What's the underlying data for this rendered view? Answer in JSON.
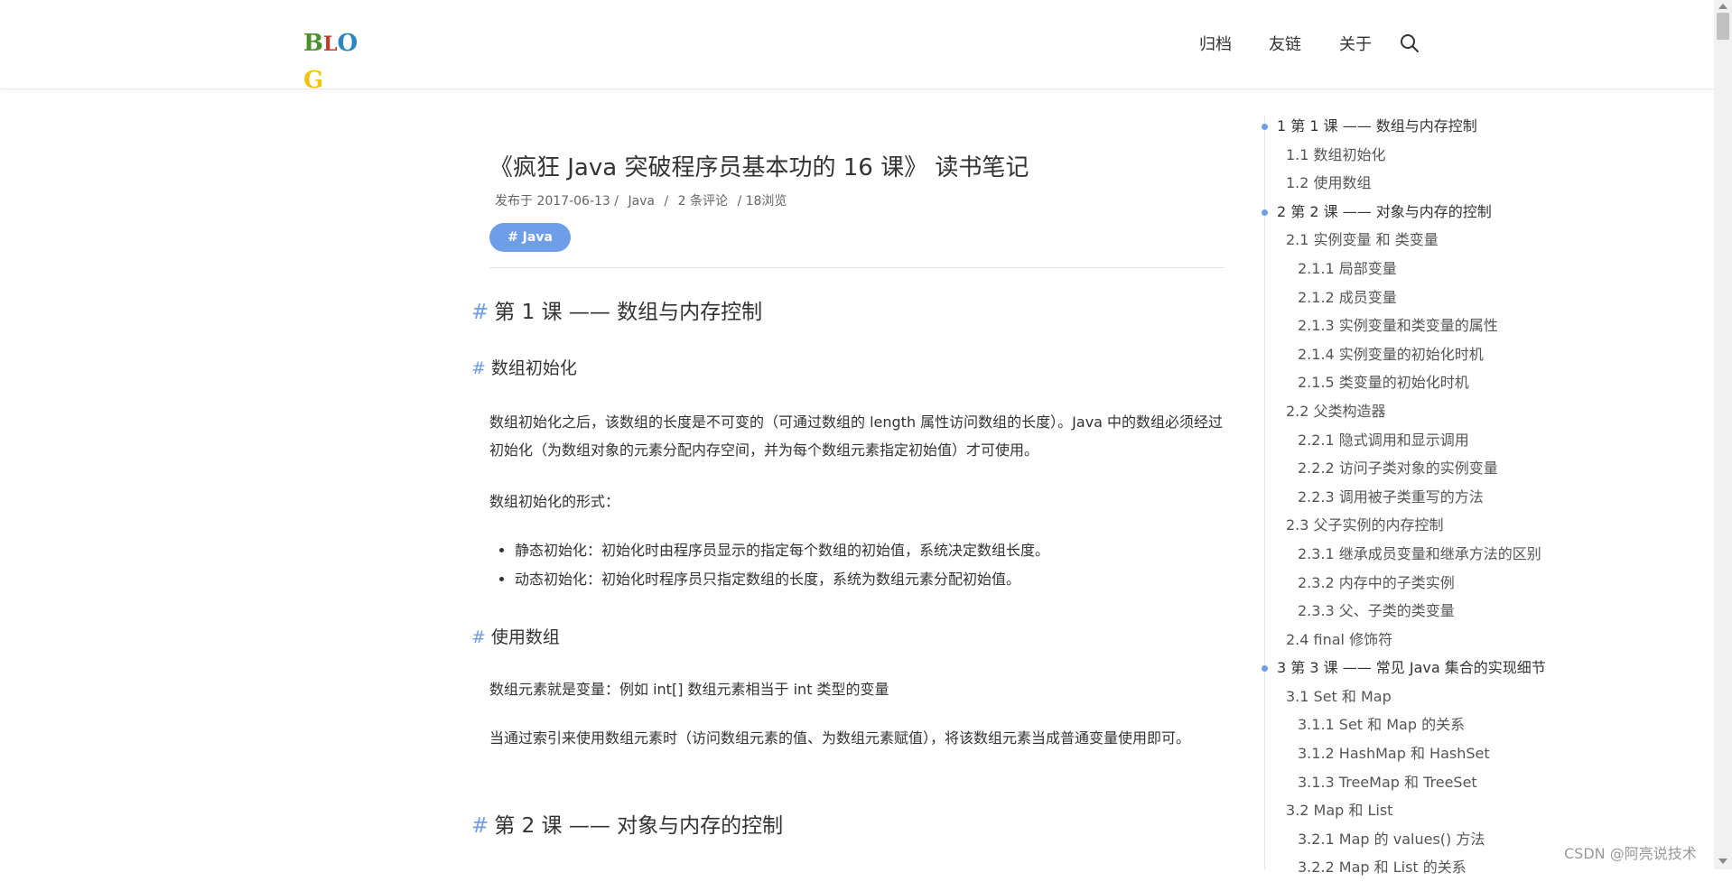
{
  "header": {
    "logo_text": "BLOG",
    "nav": {
      "archive": "归档",
      "links": "友链",
      "about": "关于"
    }
  },
  "post": {
    "title": "《疯狂 Java 突破程序员基本功的 16 课》 读书笔记",
    "meta": {
      "published": "发布于 2017-06-13 /",
      "category": "Java",
      "sep": "/",
      "comments": "2 条评论",
      "views": "/ 18浏览"
    },
    "tag": "# Java",
    "hash": "#",
    "sections": {
      "h_lesson1": "第 1 课 —— 数组与内存控制",
      "h_array_init": "数组初始化",
      "p_init1": "数组初始化之后，该数组的长度是不可变的（可通过数组的 length 属性访问数组的长度）。Java 中的数组必须经过初始化（为数组对象的元素分配内存空间，并为每个数组元素指定初始值）才可使用。",
      "p_init_form": "数组初始化的形式：",
      "bullets": [
        "静态初始化：初始化时由程序员显示的指定每个数组的初始值，系统决定数组长度。",
        "动态初始化：初始化时程序员只指定数组的长度，系统为数组元素分配初始值。"
      ],
      "h_use_array": "使用数组",
      "p_use1": "数组元素就是变量：例如 int[] 数组元素相当于 int 类型的变量",
      "p_use2": "当通过索引来使用数组元素时（访问数组元素的值、为数组元素赋值），将该数组元素当成普通变量使用即可。",
      "h_lesson2": "第 2 课 —— 对象与内存的控制"
    }
  },
  "toc": [
    {
      "level": 1,
      "label": "1 第 1 课 —— 数组与内存控制"
    },
    {
      "level": 2,
      "label": "1.1 数组初始化"
    },
    {
      "level": 2,
      "label": "1.2 使用数组"
    },
    {
      "level": 1,
      "label": "2 第 2 课 —— 对象与内存的控制"
    },
    {
      "level": 2,
      "label": "2.1 实例变量 和 类变量"
    },
    {
      "level": 3,
      "label": "2.1.1 局部变量"
    },
    {
      "level": 3,
      "label": "2.1.2 成员变量"
    },
    {
      "level": 3,
      "label": "2.1.3 实例变量和类变量的属性"
    },
    {
      "level": 3,
      "label": "2.1.4 实例变量的初始化时机"
    },
    {
      "level": 3,
      "label": "2.1.5 类变量的初始化时机"
    },
    {
      "level": 2,
      "label": "2.2 父类构造器"
    },
    {
      "level": 3,
      "label": "2.2.1 隐式调用和显示调用"
    },
    {
      "level": 3,
      "label": "2.2.2 访问子类对象的实例变量"
    },
    {
      "level": 3,
      "label": "2.2.3 调用被子类重写的方法"
    },
    {
      "level": 2,
      "label": "2.3 父子实例的内存控制"
    },
    {
      "level": 3,
      "label": "2.3.1 继承成员变量和继承方法的区别"
    },
    {
      "level": 3,
      "label": "2.3.2 内存中的子类实例"
    },
    {
      "level": 3,
      "label": "2.3.3 父、子类的类变量"
    },
    {
      "level": 2,
      "label": "2.4 final 修饰符"
    },
    {
      "level": 1,
      "label": "3 第 3 课 —— 常见 Java 集合的实现细节"
    },
    {
      "level": 2,
      "label": "3.1 Set 和 Map"
    },
    {
      "level": 3,
      "label": "3.1.1 Set 和 Map 的关系"
    },
    {
      "level": 3,
      "label": "3.1.2 HashMap 和 HashSet"
    },
    {
      "level": 3,
      "label": "3.1.3 TreeMap 和 TreeSet"
    },
    {
      "level": 2,
      "label": "3.2 Map 和 List"
    },
    {
      "level": 3,
      "label": "3.2.1 Map 的 values() 方法"
    },
    {
      "level": 3,
      "label": "3.2.2 Map 和 List 的关系"
    }
  ],
  "watermark": "CSDN @阿亮说技术",
  "colors": {
    "accent": "#6f9ee8"
  }
}
